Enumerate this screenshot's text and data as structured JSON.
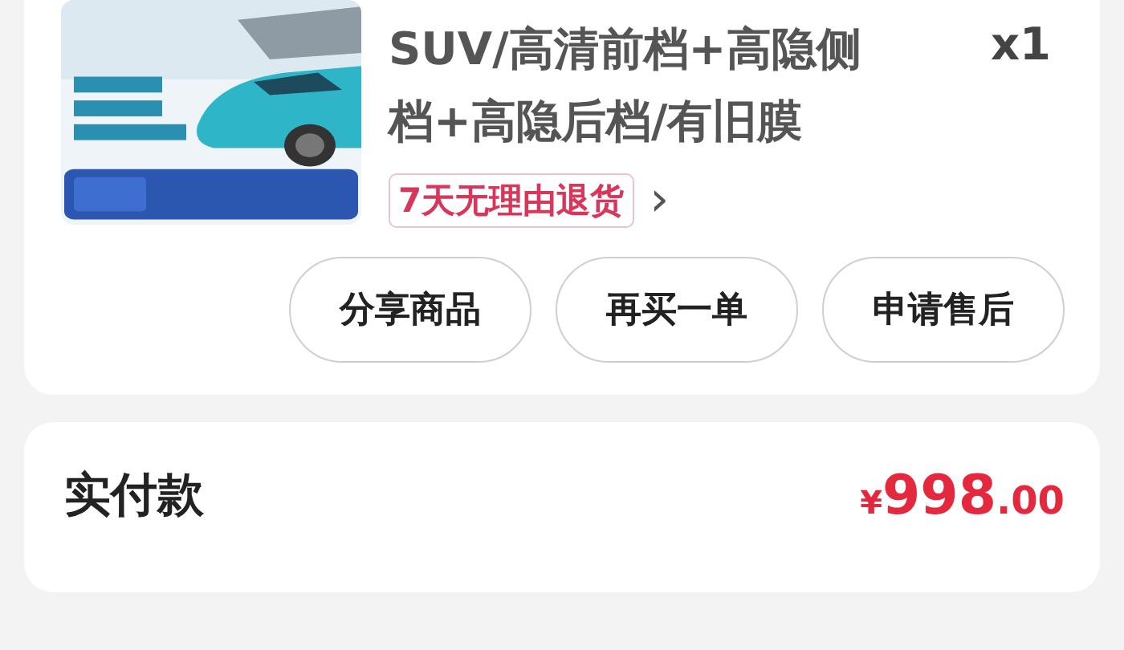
{
  "product": {
    "title": "SUV/高清前档+高隐侧档+高隐后档/有旧膜",
    "quantity": "x1",
    "tag": "7天无理由退货",
    "tag_chevron": "›"
  },
  "actions": [
    "分享商品",
    "再买一单",
    "申请售后"
  ],
  "payment": {
    "label": "实付款",
    "currency": "¥",
    "integer": "998",
    "decimal": ".00"
  }
}
